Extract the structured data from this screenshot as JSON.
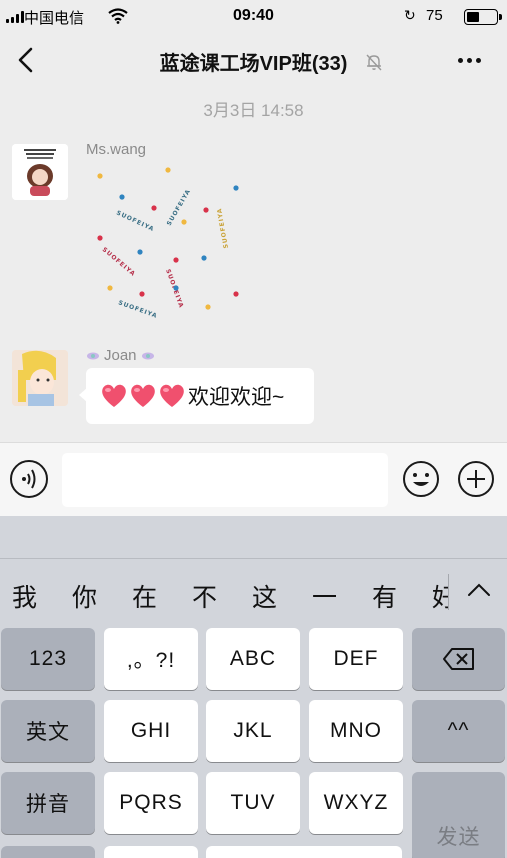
{
  "status_bar": {
    "carrier": "中国电信",
    "time": "09:40",
    "battery_percent": "75"
  },
  "header": {
    "back_icon": "chevron-left-icon",
    "title": "蓝途课工场VIP班(33)",
    "mute_icon": "bell-off-icon",
    "more_icon": "more-dots-icon"
  },
  "chat": {
    "timestamp": "3月3日 14:58",
    "messages": [
      {
        "sender": "Ms.wang",
        "type": "sticker",
        "sticker_text": "SUOFEIYA"
      },
      {
        "sender": "Joan",
        "type": "text",
        "emoji": "heart x3",
        "text": "欢迎欢迎~"
      }
    ]
  },
  "input_bar": {
    "voice_icon": "voice-icon",
    "message_value": "",
    "emoji_icon": "smiley-icon",
    "plus_icon": "plus-circle-icon"
  },
  "keyboard": {
    "candidates": [
      "我",
      "你",
      "在",
      "不",
      "这",
      "一",
      "有",
      "好"
    ],
    "rows": [
      [
        "123",
        ",。?!",
        "ABC",
        "DEF",
        "⌫"
      ],
      [
        "英文",
        "GHI",
        "JKL",
        "MNO",
        "^^"
      ],
      [
        "拼音",
        "PQRS",
        "TUV",
        "WXYZ",
        "发送"
      ]
    ]
  },
  "colors": {
    "chat_bg": "#ededed",
    "bubble_bg": "#ffffff",
    "keyboard_bg": "#d2d5db",
    "fn_key_bg": "#abb0ba"
  }
}
